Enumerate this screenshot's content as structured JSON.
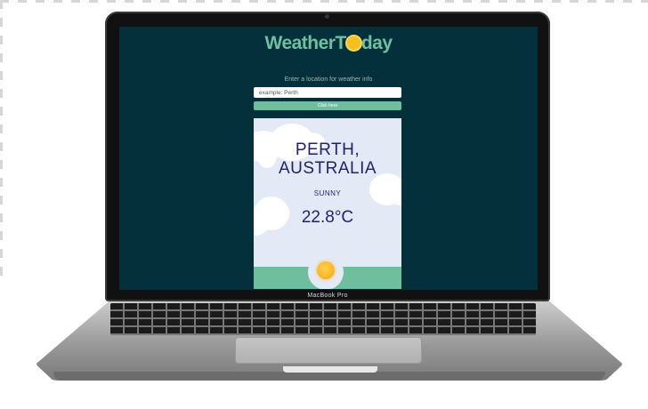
{
  "app": {
    "brand_prefix": "Weather",
    "brand_suffix": "day",
    "brand_sun_icon": "sun-icon",
    "prompt": "Enter a location for weather info",
    "input_placeholder": "example: Perth",
    "button_label": "Click here"
  },
  "weather": {
    "city": "PERTH,",
    "country": "AUSTRALIA",
    "condition": "SUNNY",
    "temperature": "22.8°C",
    "condition_icon": "sun-icon"
  },
  "device": {
    "label": "MacBook Pro"
  },
  "colors": {
    "screen_bg": "#03303a",
    "accent": "#6fbf9f",
    "card_bg": "#e4e9f6",
    "text_dark": "#241e73",
    "sun": "#f3c020"
  }
}
